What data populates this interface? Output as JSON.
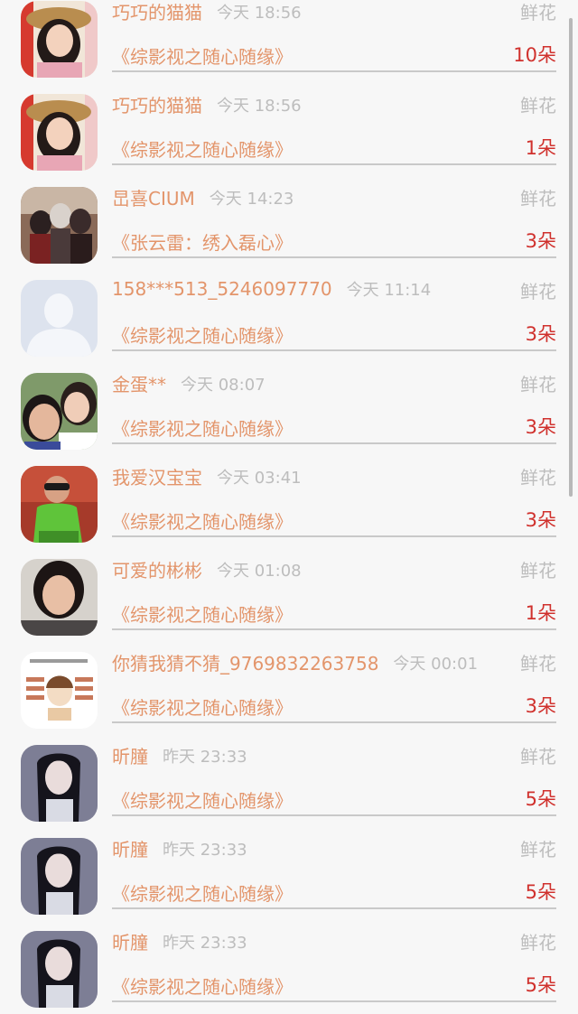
{
  "rows": [
    {
      "name": "巧巧的猫猫",
      "time": "今天 18:56",
      "gift": "鲜花",
      "book": "《综影视之随心随缘》",
      "count": "10朵",
      "avatar": "avatar-hat-woman"
    },
    {
      "name": "巧巧的猫猫",
      "time": "今天 18:56",
      "gift": "鲜花",
      "book": "《综影视之随心随缘》",
      "count": "1朵",
      "avatar": "avatar-hat-woman"
    },
    {
      "name": "旵喜CIUM",
      "time": "今天 14:23",
      "gift": "鲜花",
      "book": "《张云雷：绣入磊心》",
      "count": "3朵",
      "avatar": "avatar-anime-group"
    },
    {
      "name": "158***513_5246097770",
      "time": "今天 11:14",
      "gift": "鲜花",
      "book": "《综影视之随心随缘》",
      "count": "3朵",
      "avatar": "avatar-default-silhouette"
    },
    {
      "name": "金蛋**",
      "time": "今天 08:07",
      "gift": "鲜花",
      "book": "《综影视之随心随缘》",
      "count": "3朵",
      "avatar": "avatar-mother-child"
    },
    {
      "name": "我爱汉宝宝",
      "time": "今天 03:41",
      "gift": "鲜花",
      "book": "《综影视之随心随缘》",
      "count": "3朵",
      "avatar": "avatar-kid-green-coat"
    },
    {
      "name": "可爱的彬彬",
      "time": "今天 01:08",
      "gift": "鲜花",
      "book": "《综影视之随心随缘》",
      "count": "1朵",
      "avatar": "avatar-woman-selfie"
    },
    {
      "name": "你猜我猜不猜_9769832263758",
      "time": "今天 00:01",
      "gift": "鲜花",
      "book": "《综影视之随心随缘》",
      "count": "3朵",
      "avatar": "avatar-cartoon-sticker"
    },
    {
      "name": "昕膧",
      "time": "昨天 23:33",
      "gift": "鲜花",
      "book": "《综影视之随心随缘》",
      "count": "5朵",
      "avatar": "avatar-anime-girl"
    },
    {
      "name": "昕膧",
      "time": "昨天 23:33",
      "gift": "鲜花",
      "book": "《综影视之随心随缘》",
      "count": "5朵",
      "avatar": "avatar-anime-girl"
    },
    {
      "name": "昕膧",
      "time": "昨天 23:33",
      "gift": "鲜花",
      "book": "《综影视之随心随缘》",
      "count": "5朵",
      "avatar": "avatar-anime-girl"
    }
  ],
  "colors": {
    "name": "#e3956b",
    "count": "#d0312d",
    "muted": "#bdbdbd",
    "background": "#f7f7f7"
  }
}
